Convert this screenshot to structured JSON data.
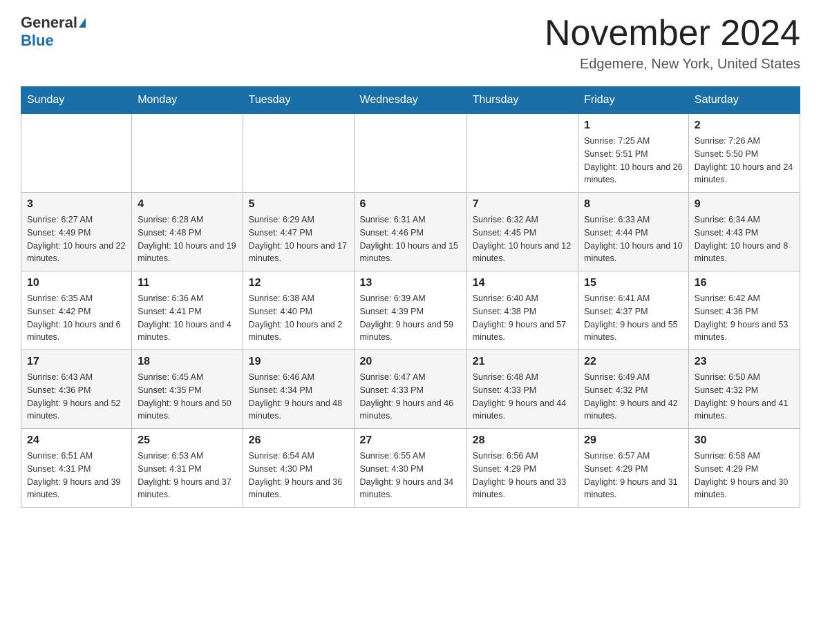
{
  "header": {
    "logo_general": "General",
    "logo_blue": "Blue",
    "title": "November 2024",
    "subtitle": "Edgemere, New York, United States"
  },
  "weekdays": [
    "Sunday",
    "Monday",
    "Tuesday",
    "Wednesday",
    "Thursday",
    "Friday",
    "Saturday"
  ],
  "weeks": [
    [
      {
        "day": "",
        "info": ""
      },
      {
        "day": "",
        "info": ""
      },
      {
        "day": "",
        "info": ""
      },
      {
        "day": "",
        "info": ""
      },
      {
        "day": "",
        "info": ""
      },
      {
        "day": "1",
        "info": "Sunrise: 7:25 AM\nSunset: 5:51 PM\nDaylight: 10 hours and 26 minutes."
      },
      {
        "day": "2",
        "info": "Sunrise: 7:26 AM\nSunset: 5:50 PM\nDaylight: 10 hours and 24 minutes."
      }
    ],
    [
      {
        "day": "3",
        "info": "Sunrise: 6:27 AM\nSunset: 4:49 PM\nDaylight: 10 hours and 22 minutes."
      },
      {
        "day": "4",
        "info": "Sunrise: 6:28 AM\nSunset: 4:48 PM\nDaylight: 10 hours and 19 minutes."
      },
      {
        "day": "5",
        "info": "Sunrise: 6:29 AM\nSunset: 4:47 PM\nDaylight: 10 hours and 17 minutes."
      },
      {
        "day": "6",
        "info": "Sunrise: 6:31 AM\nSunset: 4:46 PM\nDaylight: 10 hours and 15 minutes."
      },
      {
        "day": "7",
        "info": "Sunrise: 6:32 AM\nSunset: 4:45 PM\nDaylight: 10 hours and 12 minutes."
      },
      {
        "day": "8",
        "info": "Sunrise: 6:33 AM\nSunset: 4:44 PM\nDaylight: 10 hours and 10 minutes."
      },
      {
        "day": "9",
        "info": "Sunrise: 6:34 AM\nSunset: 4:43 PM\nDaylight: 10 hours and 8 minutes."
      }
    ],
    [
      {
        "day": "10",
        "info": "Sunrise: 6:35 AM\nSunset: 4:42 PM\nDaylight: 10 hours and 6 minutes."
      },
      {
        "day": "11",
        "info": "Sunrise: 6:36 AM\nSunset: 4:41 PM\nDaylight: 10 hours and 4 minutes."
      },
      {
        "day": "12",
        "info": "Sunrise: 6:38 AM\nSunset: 4:40 PM\nDaylight: 10 hours and 2 minutes."
      },
      {
        "day": "13",
        "info": "Sunrise: 6:39 AM\nSunset: 4:39 PM\nDaylight: 9 hours and 59 minutes."
      },
      {
        "day": "14",
        "info": "Sunrise: 6:40 AM\nSunset: 4:38 PM\nDaylight: 9 hours and 57 minutes."
      },
      {
        "day": "15",
        "info": "Sunrise: 6:41 AM\nSunset: 4:37 PM\nDaylight: 9 hours and 55 minutes."
      },
      {
        "day": "16",
        "info": "Sunrise: 6:42 AM\nSunset: 4:36 PM\nDaylight: 9 hours and 53 minutes."
      }
    ],
    [
      {
        "day": "17",
        "info": "Sunrise: 6:43 AM\nSunset: 4:36 PM\nDaylight: 9 hours and 52 minutes."
      },
      {
        "day": "18",
        "info": "Sunrise: 6:45 AM\nSunset: 4:35 PM\nDaylight: 9 hours and 50 minutes."
      },
      {
        "day": "19",
        "info": "Sunrise: 6:46 AM\nSunset: 4:34 PM\nDaylight: 9 hours and 48 minutes."
      },
      {
        "day": "20",
        "info": "Sunrise: 6:47 AM\nSunset: 4:33 PM\nDaylight: 9 hours and 46 minutes."
      },
      {
        "day": "21",
        "info": "Sunrise: 6:48 AM\nSunset: 4:33 PM\nDaylight: 9 hours and 44 minutes."
      },
      {
        "day": "22",
        "info": "Sunrise: 6:49 AM\nSunset: 4:32 PM\nDaylight: 9 hours and 42 minutes."
      },
      {
        "day": "23",
        "info": "Sunrise: 6:50 AM\nSunset: 4:32 PM\nDaylight: 9 hours and 41 minutes."
      }
    ],
    [
      {
        "day": "24",
        "info": "Sunrise: 6:51 AM\nSunset: 4:31 PM\nDaylight: 9 hours and 39 minutes."
      },
      {
        "day": "25",
        "info": "Sunrise: 6:53 AM\nSunset: 4:31 PM\nDaylight: 9 hours and 37 minutes."
      },
      {
        "day": "26",
        "info": "Sunrise: 6:54 AM\nSunset: 4:30 PM\nDaylight: 9 hours and 36 minutes."
      },
      {
        "day": "27",
        "info": "Sunrise: 6:55 AM\nSunset: 4:30 PM\nDaylight: 9 hours and 34 minutes."
      },
      {
        "day": "28",
        "info": "Sunrise: 6:56 AM\nSunset: 4:29 PM\nDaylight: 9 hours and 33 minutes."
      },
      {
        "day": "29",
        "info": "Sunrise: 6:57 AM\nSunset: 4:29 PM\nDaylight: 9 hours and 31 minutes."
      },
      {
        "day": "30",
        "info": "Sunrise: 6:58 AM\nSunset: 4:29 PM\nDaylight: 9 hours and 30 minutes."
      }
    ]
  ]
}
